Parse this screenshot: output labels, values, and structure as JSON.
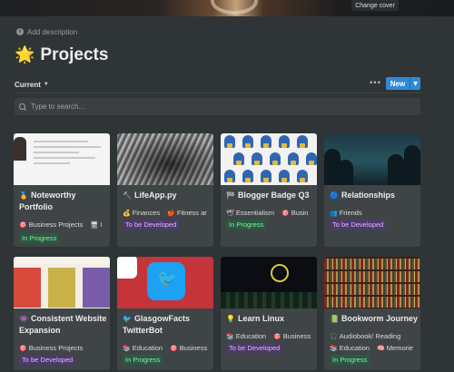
{
  "cover": {
    "change_label": "Change cover"
  },
  "header": {
    "add_description": "Add description",
    "title_emoji": "🌟",
    "title": "Projects"
  },
  "toolbar": {
    "view": "Current",
    "more": "•••",
    "new_label": "New"
  },
  "search": {
    "placeholder": "Type to search..."
  },
  "cards": [
    {
      "icon": "🥇",
      "title": "Noteworthy Portfolio",
      "tags": [
        {
          "icon": "🎯",
          "label": "Business Projects"
        },
        {
          "icon": "🖥",
          "label": "I"
        }
      ],
      "status": "In Progress",
      "status_type": "progress"
    },
    {
      "icon": "🔨",
      "title": "LifeApp.py",
      "tags": [
        {
          "icon": "💰",
          "label": "Finances"
        },
        {
          "icon": "🍎",
          "label": "Fitness ar"
        }
      ],
      "status": "To be Developed",
      "status_type": "dev"
    },
    {
      "icon": "🏁",
      "title": "Blogger Badge Q3",
      "tags": [
        {
          "icon": "🕊",
          "label": "Essentialism"
        },
        {
          "icon": "🎯",
          "label": "Busin"
        }
      ],
      "status": "In Progress",
      "status_type": "progress"
    },
    {
      "icon": "🔵",
      "title": "Relationships",
      "tags": [
        {
          "icon": "👥",
          "label": "Friends"
        }
      ],
      "status": "To be Developed",
      "status_type": "dev"
    },
    {
      "icon": "👾",
      "title": "Consistent Website Expansion",
      "tags": [
        {
          "icon": "🎯",
          "label": "Business Projects"
        }
      ],
      "status": "To be Developed",
      "status_type": "dev"
    },
    {
      "icon": "🐦",
      "title": "GlasgowFacts TwitterBot",
      "tags": [
        {
          "icon": "📚",
          "label": "Education"
        },
        {
          "icon": "🎯",
          "label": "Business"
        }
      ],
      "status": "In Progress",
      "status_type": "progress"
    },
    {
      "icon": "💡",
      "title": "Learn Linux",
      "tags": [
        {
          "icon": "📚",
          "label": "Education"
        },
        {
          "icon": "🎯",
          "label": "Business"
        }
      ],
      "status": "To be Developed",
      "status_type": "dev"
    },
    {
      "icon": "📗",
      "title": "Bookworm Journey",
      "tags": [
        {
          "icon": "🎧",
          "label": "Audiobook/ Reading"
        }
      ],
      "tags2": [
        {
          "icon": "📚",
          "label": "Education"
        },
        {
          "icon": "🧠",
          "label": "Memorie"
        }
      ],
      "status": "In Progress",
      "status_type": "progress"
    }
  ]
}
